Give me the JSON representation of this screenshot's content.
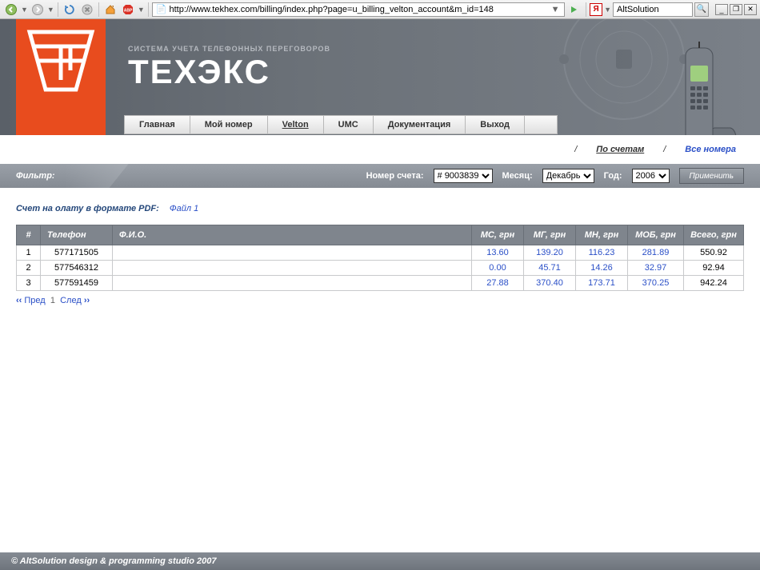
{
  "browser": {
    "url": "http://www.tekhex.com/billing/index.php?page=u_billing_velton_account&m_id=148",
    "search_value": "AltSolution"
  },
  "brand": {
    "subtitle": "СИСТЕМА УЧЕТА ТЕЛЕФОННЫХ ПЕРЕГОВОРОВ",
    "title": "ТЕХЭКС"
  },
  "nav": {
    "items": [
      "Главная",
      "Мой номер",
      "Velton",
      "UMC",
      "Документация",
      "Выход"
    ],
    "active_index": 2
  },
  "subnav": {
    "sep": "/",
    "by_accounts": "По счетам",
    "all_numbers": "Все номера"
  },
  "filter": {
    "label": "Фильтр:",
    "account_label": "Номер счета:",
    "account_value": "# 9003839",
    "month_label": "Месяц:",
    "month_value": "Декабрь",
    "year_label": "Год:",
    "year_value": "2006",
    "apply": "Применить"
  },
  "pdf": {
    "label": "Счет на олату в формате PDF:",
    "link": "Файл 1"
  },
  "table": {
    "headers": [
      "#",
      "Телефон",
      "Ф.И.О.",
      "МС, грн",
      "МГ, грн",
      "МН, грн",
      "МОБ, грн",
      "Всего, грн"
    ],
    "rows": [
      {
        "n": "1",
        "phone": "577171505",
        "fio": "",
        "ms": "13.60",
        "mg": "139.20",
        "mn": "116.23",
        "mob": "281.89",
        "total": "550.92"
      },
      {
        "n": "2",
        "phone": "577546312",
        "fio": "",
        "ms": "0.00",
        "mg": "45.71",
        "mn": "14.26",
        "mob": "32.97",
        "total": "92.94"
      },
      {
        "n": "3",
        "phone": "577591459",
        "fio": "",
        "ms": "27.88",
        "mg": "370.40",
        "mn": "173.71",
        "mob": "370.25",
        "total": "942.24"
      }
    ]
  },
  "pager": {
    "prev": "Пред",
    "page": "1",
    "next": "След"
  },
  "footer": "© AltSolution design & programming studio 2007"
}
